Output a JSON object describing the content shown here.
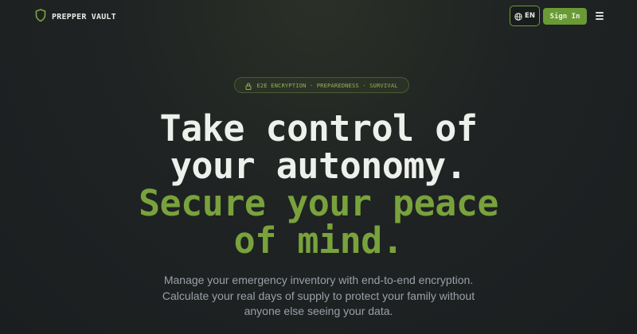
{
  "brand": {
    "name": "PREPPER VAULT",
    "icon": "shield-icon"
  },
  "nav": {
    "language_label": "EN",
    "language_icon": "globe-icon",
    "signin_label": "Sign In",
    "menu_icon": "menu-icon"
  },
  "badge": {
    "icon": "lock-icon",
    "text": "E2E ENCRYPTION · PREPAREDNESS · SURVIVAL"
  },
  "hero": {
    "line1": "Take control of",
    "line2": "your autonomy.",
    "line3": "Secure your peace",
    "line4": "of mind.",
    "subtitle": "Manage your emergency inventory with end-to-end encryption. Calculate your real days of supply to protect your family without anyone else seeing your data."
  },
  "colors": {
    "accent": "#79a23c",
    "button": "#6a9a36",
    "background": "#1f2323",
    "text_muted": "#9aa0a8"
  }
}
